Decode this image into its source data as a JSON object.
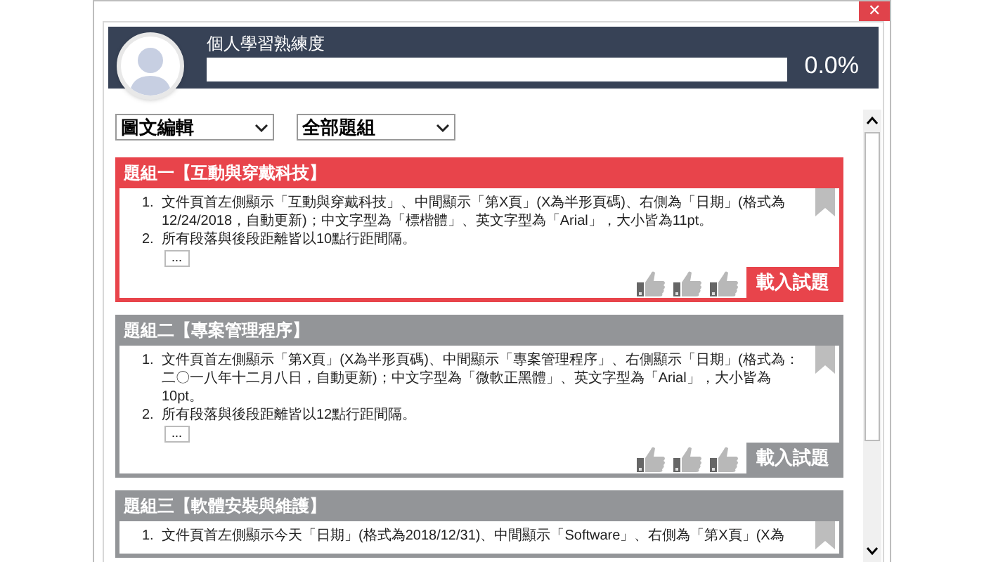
{
  "window": {
    "close": "✕"
  },
  "profile": {
    "title": "個人學習熟練度",
    "level": 0.0,
    "reading": "0.0%"
  },
  "filters": [
    {
      "value": "圖文編輯"
    },
    {
      "value": "全部題組"
    }
  ],
  "cards": [
    {
      "title": "題組一【互動與穿戴科技】",
      "selected": true,
      "items": [
        {
          "number": "1.",
          "text": "文件頁首左側顯示「互動與穿戴科技」、中間顯示「第X頁」(X為半形頁碼)、右側為「日期」(格式為12/24/2018，自動更新)；中文字型為「標楷體」、英文字型為「Arial」，大小皆為11pt。"
        },
        {
          "number": "2.",
          "text": "所有段落與後段距離皆以10點行距間隔。"
        }
      ],
      "more_button": "...",
      "load_button": "載入試題"
    },
    {
      "title": "題組二【專案管理程序】",
      "selected": false,
      "items": [
        {
          "number": "1.",
          "text": "文件頁首左側顯示「第X頁」(X為半形頁碼)、中間顯示「專案管理程序」、右側顯示「日期」(格式為：二〇一八年十二月八日，自動更新)；中文字型為「微軟正黑體」、英文字型為「Arial」，大小皆為10pt。"
        },
        {
          "number": "2.",
          "text": "所有段落與後段距離皆以12點行距間隔。"
        }
      ],
      "more_button": "...",
      "load_button": "載入試題"
    },
    {
      "title": "題組三【軟體安裝與維護】",
      "selected": false,
      "items": [
        {
          "number": "1.",
          "text": "文件頁首左側顯示今天「日期」(格式為2018/12/31)、中間顯示「Software」、右側為「第X頁」(X為"
        }
      ]
    }
  ]
}
